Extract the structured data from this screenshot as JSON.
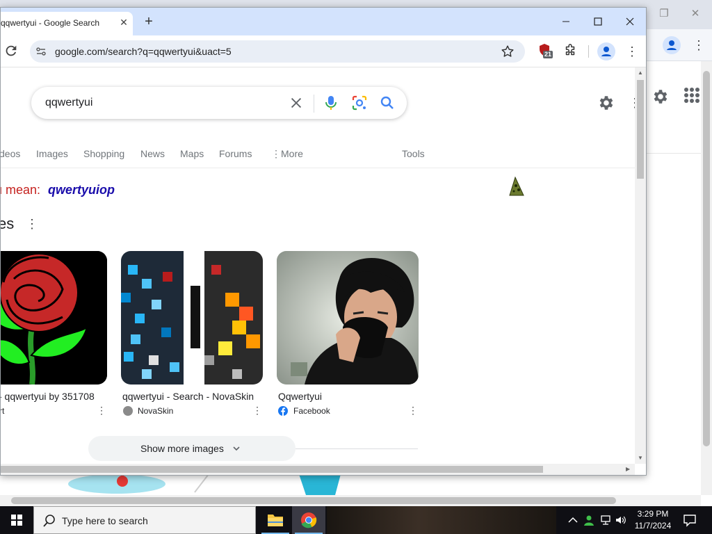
{
  "browser": {
    "tab_title": "qqwertyui - Google Search",
    "url": "google.com/search?q=qqwertyui&uact=5",
    "extension_badge": "21"
  },
  "search": {
    "query": "qqwertyui"
  },
  "nav": {
    "items": [
      "deos",
      "Images",
      "Shopping",
      "News",
      "Maps",
      "Forums",
      "More"
    ],
    "tools": "Tools"
  },
  "did_you_mean": {
    "prefix": "u mean:",
    "suggestion": "qwertyuiop"
  },
  "images_section": {
    "title": "es",
    "results": [
      {
        "title": "- qqwertyui by 351708",
        "source": "rt"
      },
      {
        "title": "qqwertyui - Search - NovaSkin",
        "source": "NovaSkin"
      },
      {
        "title": "Qqwertyui",
        "source": "Facebook"
      }
    ],
    "show_more": "Show more images"
  },
  "taskbar": {
    "search_placeholder": "Type here to search",
    "time": "3:29 PM",
    "date": "11/7/2024"
  },
  "colors": {
    "tabstrip": "#d3e3fd",
    "link_blue": "#1a0dab",
    "did_you_mean_red": "#c5221f",
    "google_blue": "#4285f4",
    "google_red": "#ea4335",
    "google_yellow": "#fbbc04",
    "google_green": "#34a853"
  }
}
